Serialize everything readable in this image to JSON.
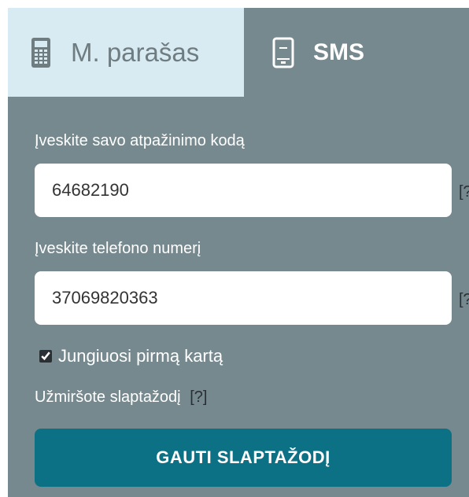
{
  "tabs": {
    "mobile_signature": {
      "label": "M. parašas",
      "icon": "mobile-keypad-icon"
    },
    "sms": {
      "label": "SMS",
      "icon": "phone-icon",
      "active": true
    }
  },
  "form": {
    "code_label": "Įveskite savo atpažinimo kodą",
    "code_value": "64682190",
    "phone_label": "Įveskite telefono numerį",
    "phone_value": "37069820363",
    "help_marker": "[?]",
    "first_time_label": "Jungiuosi pirmą kartą",
    "first_time_checked": true,
    "forgot_label": "Užmiršote slaptažodį",
    "forgot_help": "[?]",
    "submit_label": "GAUTI SLAPTAŽODĮ"
  },
  "colors": {
    "panel": "#76898f",
    "tab_inactive": "#d8eaf2",
    "button": "#0d7185"
  }
}
